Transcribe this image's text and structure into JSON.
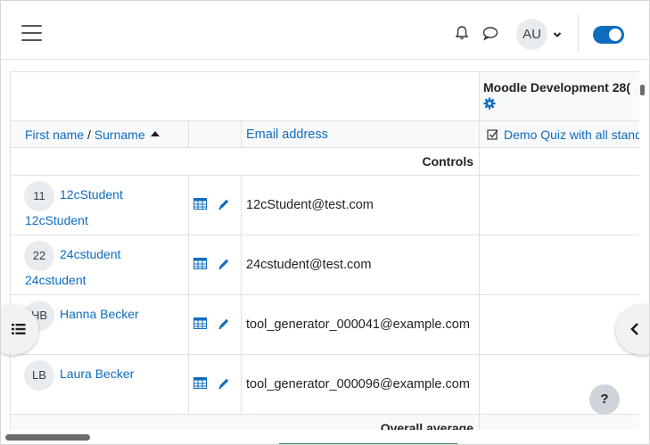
{
  "header": {
    "menu_icon": "hamburger-icon",
    "notifications_icon": "bell-icon",
    "messages_icon": "chat-bubble-icon",
    "user_initials": "AU",
    "user_menu_icon": "chevron-down-icon",
    "edit_mode_toggle": "on"
  },
  "table": {
    "course_title": "Moodle Development 28(",
    "course_settings_icon": "gear-icon",
    "columns": {
      "first_name": "First name",
      "separator": "/",
      "surname": "Surname",
      "email": "Email address",
      "quiz": "Demo Quiz with all stand"
    },
    "controls_label": "Controls",
    "overall_average_label": "Overall average",
    "rows": [
      {
        "initials": "11",
        "name_line1": "12cStudent",
        "name_line2": "12cStudent",
        "email": "12cStudent@test.com"
      },
      {
        "initials": "22",
        "name_line1": "24cstudent",
        "name_line2": "24cstudent",
        "email": "24cstudent@test.com"
      },
      {
        "initials": "HB",
        "name_line1": "Hanna Becker",
        "name_line2": "",
        "email": "tool_generator_000041@example.com"
      },
      {
        "initials": "LB",
        "name_line1": "Laura Becker",
        "name_line2": "",
        "email": "tool_generator_000096@example.com"
      }
    ]
  },
  "help_button": "?",
  "colors": {
    "link": "#0f6cbf",
    "toggle": "#0f6cbf"
  }
}
